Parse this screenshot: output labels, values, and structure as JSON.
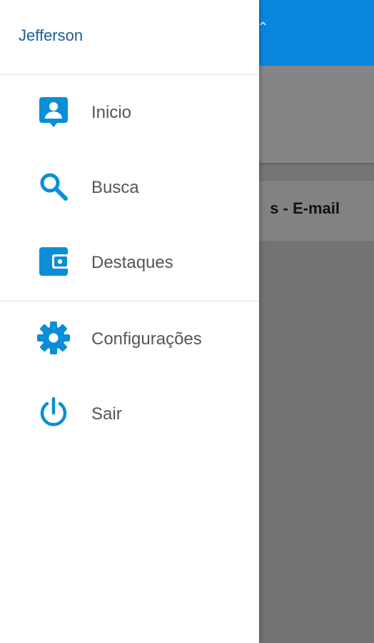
{
  "background": {
    "card_title": "s - E-mail"
  },
  "drawer": {
    "user_name": "Jefferson",
    "primary_items": [
      {
        "label": "Inicio",
        "icon": "account-box-icon"
      },
      {
        "label": "Busca",
        "icon": "search-icon"
      },
      {
        "label": "Destaques",
        "icon": "wallet-icon"
      }
    ],
    "secondary_items": [
      {
        "label": "Configurações",
        "icon": "gear-icon"
      },
      {
        "label": "Sair",
        "icon": "power-icon"
      }
    ]
  },
  "colors": {
    "accent": "#0b8ed8",
    "app_bar": "#0a86e0",
    "user_name": "#1d5f99",
    "scrim": "#767676"
  }
}
